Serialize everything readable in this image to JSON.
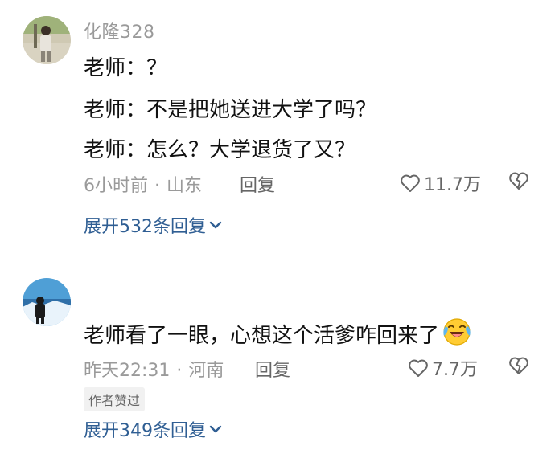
{
  "comments": [
    {
      "username": "化隆328",
      "lines": [
        "老师：？",
        "老师：不是把她送进大学了吗？",
        "老师：怎么？大学退货了又？"
      ],
      "time": "6小时前",
      "separator": "·",
      "location": "山东",
      "reply_label": "回复",
      "likes": "11.7万",
      "expand_label": "展开532条回复",
      "avatar_icon": "person-outdoor-avatar-icon",
      "like_icon": "heart-outline-icon",
      "dislike_icon": "broken-heart-icon",
      "expand_icon": "chevron-down-icon"
    },
    {
      "username": "",
      "lines": [
        "老师看了一眼，心想这个活爹咋回来了"
      ],
      "emoji_icon": "laughing-crying-emoji-icon",
      "time": "昨天22:31",
      "separator": "·",
      "location": "河南",
      "reply_label": "回复",
      "likes": "7.7万",
      "badge": "作者赞过",
      "expand_label": "展开349条回复",
      "avatar_icon": "person-snow-avatar-icon",
      "like_icon": "heart-outline-icon",
      "dislike_icon": "broken-heart-icon",
      "expand_icon": "chevron-down-icon"
    }
  ],
  "colors": {
    "username": "#9a9a9a",
    "text": "#111111",
    "meta": "#9a9a9a",
    "link": "#2f5e93",
    "badge_bg": "#f1f1f1",
    "divider": "#efefef"
  }
}
